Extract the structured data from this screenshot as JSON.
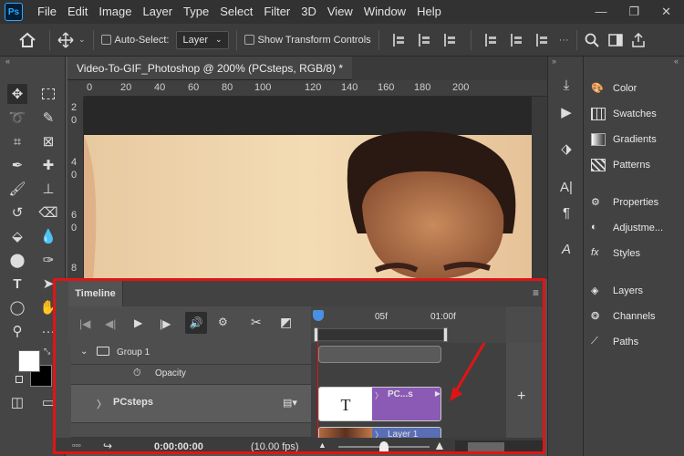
{
  "app": {
    "logo_text": "Ps"
  },
  "menubar": {
    "items": [
      "File",
      "Edit",
      "Image",
      "Layer",
      "Type",
      "Select",
      "Filter",
      "3D",
      "View",
      "Window",
      "Help"
    ],
    "minimize": "—",
    "restore": "❐",
    "close": "✕"
  },
  "options": {
    "auto_select_label": "Auto-Select:",
    "layer_select_value": "Layer",
    "show_transform_label": "Show Transform Controls"
  },
  "document": {
    "tab_title": "Video-To-GIF_Photoshop @ 200% (PCsteps, RGB/8) *",
    "close": "×"
  },
  "ruler": {
    "h_labels": [
      "0",
      "20",
      "40",
      "60",
      "80",
      "100",
      "120",
      "140",
      "160",
      "180",
      "200"
    ],
    "v_labels": [
      "2",
      "0",
      "4",
      "0",
      "6",
      "0",
      "8"
    ]
  },
  "right_panel": {
    "group1": [
      "Color",
      "Swatches",
      "Gradients",
      "Patterns"
    ],
    "group2": [
      "Properties",
      "Adjustme...",
      "Styles"
    ],
    "group3": [
      "Layers",
      "Channels",
      "Paths"
    ]
  },
  "timeline": {
    "title": "Timeline",
    "group_label": "Group 1",
    "opacity_label": "Opacity",
    "layer_label": "PCsteps",
    "ruler_labels": [
      "05f",
      "01:00f"
    ],
    "clip_text_label": "PC...s",
    "clip_text_glyph": "T",
    "clip_image_label": "Layer 1",
    "time_code": "0:00:00:00",
    "fps": "(10.00 fps)",
    "add_track": "+"
  },
  "colors": {
    "accent_red": "#e11414",
    "clip_purple": "#8a5ab5",
    "clip_blue": "#5a6eb5",
    "playhead": "#4a90e2"
  }
}
